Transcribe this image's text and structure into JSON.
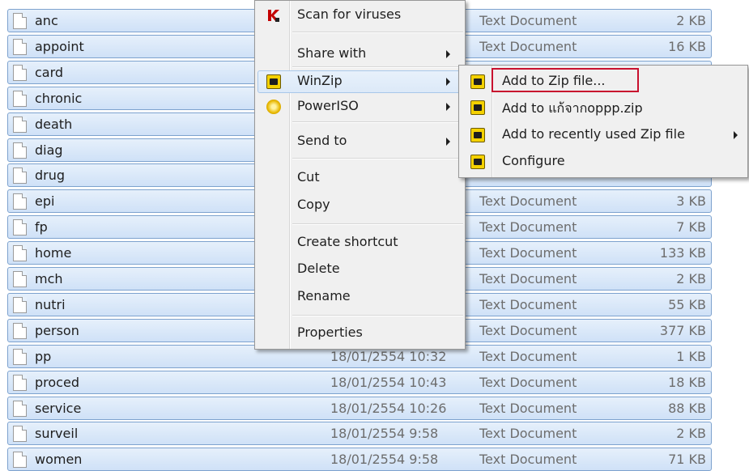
{
  "files": [
    {
      "name": "anc",
      "date": "",
      "type": "Text Document",
      "size": "2 KB"
    },
    {
      "name": "appoint",
      "date": "",
      "type": "Text Document",
      "size": "16 KB"
    },
    {
      "name": "card",
      "date": "",
      "type": "",
      "size": ""
    },
    {
      "name": "chronic",
      "date": "",
      "type": "",
      "size": ""
    },
    {
      "name": "death",
      "date": "",
      "type": "",
      "size": ""
    },
    {
      "name": "diag",
      "date": "",
      "type": "",
      "size": ""
    },
    {
      "name": "drug",
      "date": "",
      "type": "",
      "size": ""
    },
    {
      "name": "epi",
      "date": "",
      "type": "Text Document",
      "size": "3 KB"
    },
    {
      "name": "fp",
      "date": "",
      "type": "Text Document",
      "size": "7 KB"
    },
    {
      "name": "home",
      "date": "",
      "type": "Text Document",
      "size": "133 KB"
    },
    {
      "name": "mch",
      "date": "",
      "type": "Text Document",
      "size": "2 KB"
    },
    {
      "name": "nutri",
      "date": "",
      "type": "Text Document",
      "size": "55 KB"
    },
    {
      "name": "person",
      "date": "",
      "type": "Text Document",
      "size": "377 KB"
    },
    {
      "name": "pp",
      "date": "18/01/2554 10:32",
      "type": "Text Document",
      "size": "1 KB"
    },
    {
      "name": "proced",
      "date": "18/01/2554 10:43",
      "type": "Text Document",
      "size": "18 KB"
    },
    {
      "name": "service",
      "date": "18/01/2554 10:26",
      "type": "Text Document",
      "size": "88 KB"
    },
    {
      "name": "surveil",
      "date": "18/01/2554 9:58",
      "type": "Text Document",
      "size": "2 KB"
    },
    {
      "name": "women",
      "date": "18/01/2554 9:58",
      "type": "Text Document",
      "size": "71 KB"
    }
  ],
  "context_menu": {
    "scan": "Scan for viruses",
    "share_with": "Share with",
    "winzip": "WinZip",
    "poweriso": "PowerISO",
    "send_to": "Send to",
    "cut": "Cut",
    "copy": "Copy",
    "create_shortcut": "Create shortcut",
    "delete": "Delete",
    "rename": "Rename",
    "properties": "Properties"
  },
  "winzip_submenu": {
    "add_to_zip": "Add to Zip file...",
    "add_to_named": "Add to แก้จากoppp.zip",
    "add_recent": "Add to recently used Zip file",
    "configure": "Configure"
  },
  "colors": {
    "selection_fill": "#cfe1f7",
    "selection_border": "#7da2ce",
    "menu_bg": "#f0f0f0",
    "highlight_box": "#c8102e"
  },
  "icons": {
    "file": "text-file-icon",
    "scan": "kaspersky-icon",
    "winzip": "winzip-icon",
    "poweriso": "poweriso-icon"
  }
}
